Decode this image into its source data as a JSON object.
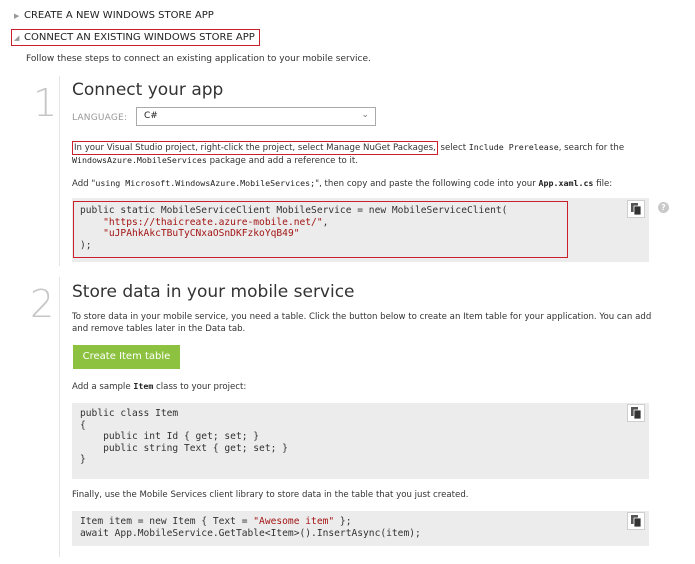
{
  "accordion": {
    "collapsed_item": {
      "label": "CREATE A NEW WINDOWS STORE APP",
      "icon": "triangle-right-icon"
    },
    "expanded_item": {
      "label": "CONNECT AN EXISTING WINDOWS STORE APP",
      "icon": "triangle-down-icon"
    }
  },
  "intro": "Follow these steps to connect an existing application to your mobile service.",
  "step1": {
    "number": "1",
    "title": "Connect your app",
    "language_label": "LANGUAGE:",
    "language_value": "C#",
    "instruction_highlight": "In your Visual Studio project, right-click the project, select Manage NuGet Packages,",
    "instruction_part2": " select ",
    "instruction_code1": "Include Prerelease",
    "instruction_part3": ", search for the",
    "instruction_code2": "WindowsAzure.MobileServices",
    "instruction_part4": " package and add a reference to it.",
    "add_prefix": "Add \"",
    "add_code": "using Microsoft.WindowsAzure.MobileServices;",
    "add_middle": "\", then copy and paste the following code into your ",
    "add_file": "App.xaml.cs",
    "add_suffix": " file:",
    "code": {
      "line1": "public static MobileServiceClient MobileService = new MobileServiceClient(",
      "line2_indent": "    ",
      "line2_str": "\"https://thaicreate.azure-mobile.net/\"",
      "line2_tail": ",",
      "line3_indent": "    ",
      "line3_str": "\"uJPAhkAkcTBuTyCNxaOSnDKFzkoYqB49\"",
      "line4": ");"
    },
    "help_icon": "?"
  },
  "step2": {
    "number": "2",
    "title": "Store data in your mobile service",
    "desc_line1": "To store data in your mobile service, you need a table. Click the button below to create an Item table for your application. You can add",
    "desc_line2": "and remove tables later in the Data tab.",
    "button_label": "Create Item table",
    "sample_prefix": "Add a sample ",
    "sample_code": "Item",
    "sample_suffix": " class to your project:",
    "class_code": {
      "line1": "public class Item",
      "line2": "{",
      "line3": "    public int Id { get; set; }",
      "line4": "    public string Text { get; set; }",
      "line5": "}"
    },
    "finally_text": "Finally, use the Mobile Services client library to store data in the table that you just created.",
    "insert_code": {
      "line1_a": "Item item = new Item { Text = ",
      "line1_str": "\"Awesome item\"",
      "line1_b": " };",
      "line2": "await App.MobileService.GetTable<Item>().InsertAsync(item);"
    }
  },
  "colors": {
    "accent_red": "#c8202c",
    "button_green": "#8cc23f",
    "code_bg": "#ececec",
    "string_red": "#a31515"
  }
}
